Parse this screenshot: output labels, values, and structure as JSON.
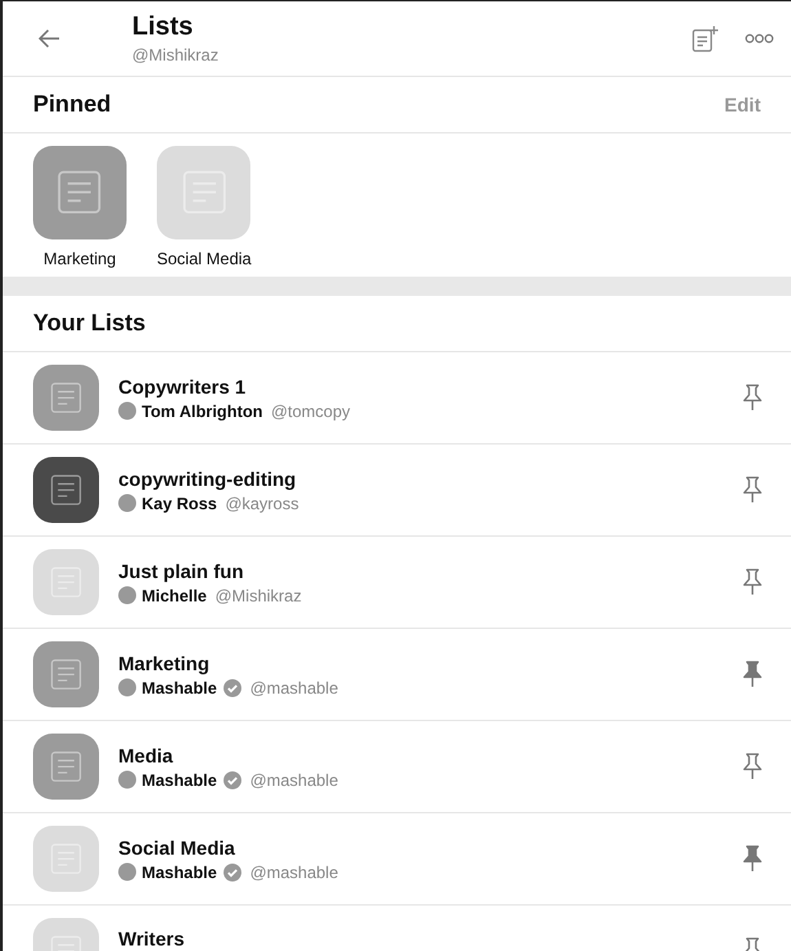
{
  "header": {
    "title": "Lists",
    "subtitle": "@Mishikraz"
  },
  "pinned": {
    "title": "Pinned",
    "edit": "Edit",
    "items": [
      {
        "name": "Marketing",
        "color": "#9b9b9b"
      },
      {
        "name": "Social Media",
        "color": "#dcdcdc"
      }
    ]
  },
  "your_lists": {
    "title": "Your Lists",
    "items": [
      {
        "name": "Copywriters 1",
        "color": "#9b9b9b",
        "owner": "Tom Albrighton",
        "handle": "@tomcopy",
        "verified": false,
        "pinned": false
      },
      {
        "name": "copywriting-editing",
        "color": "#4a4a4a",
        "owner": "Kay Ross",
        "handle": "@kayross",
        "verified": false,
        "pinned": false
      },
      {
        "name": "Just plain fun",
        "color": "#dcdcdc",
        "owner": "Michelle",
        "handle": "@Mishikraz",
        "verified": false,
        "pinned": false
      },
      {
        "name": "Marketing",
        "color": "#9b9b9b",
        "owner": "Mashable",
        "handle": "@mashable",
        "verified": true,
        "pinned": true
      },
      {
        "name": "Media",
        "color": "#9b9b9b",
        "owner": "Mashable",
        "handle": "@mashable",
        "verified": true,
        "pinned": false
      },
      {
        "name": "Social Media",
        "color": "#dcdcdc",
        "owner": "Mashable",
        "handle": "@mashable",
        "verified": true,
        "pinned": true
      },
      {
        "name": "Writers",
        "color": "#dcdcdc",
        "pinned": false
      }
    ]
  }
}
